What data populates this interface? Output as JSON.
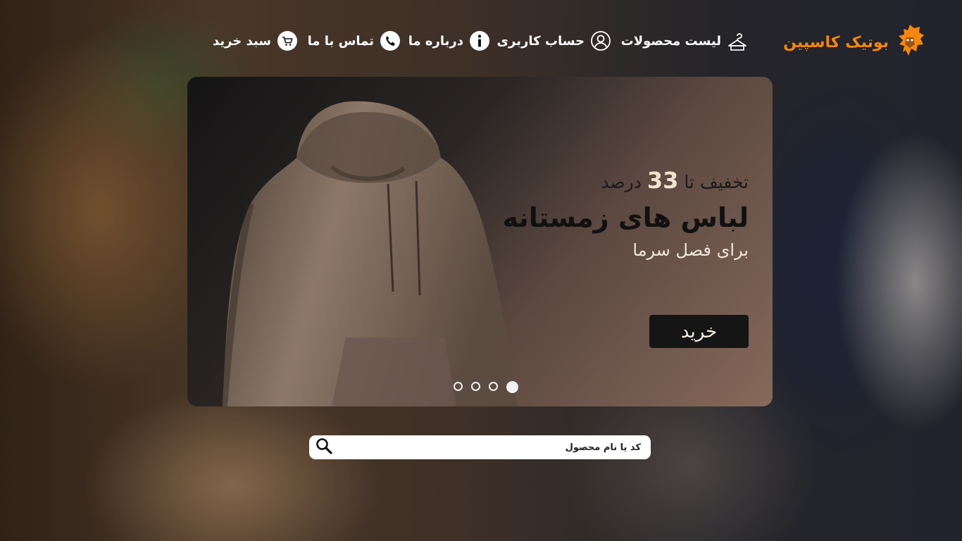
{
  "brand": {
    "name": "بوتیک کاسپین",
    "accent_color": "#f5860f",
    "logo_icon": "lion-icon"
  },
  "nav": {
    "items": [
      {
        "label": "لیست محصولات",
        "icon": "hanger-icon"
      },
      {
        "label": "حساب کاربری",
        "icon": "user-icon"
      },
      {
        "label": "درباره ما",
        "icon": "info-icon"
      },
      {
        "label": "تماس با ما",
        "icon": "phone-icon"
      },
      {
        "label": "سبد خرید",
        "icon": "cart-icon"
      }
    ]
  },
  "banner": {
    "discount_prefix": "تخفیف تا",
    "discount_value": "33",
    "discount_suffix": "درصد",
    "title": "لباس های زمستانه",
    "subtitle": "برای فصل سرما",
    "button_label": "خرید",
    "slides_count": 4,
    "active_slide": 1
  },
  "search": {
    "placeholder": "کد یا نام محصول",
    "icon": "search-icon"
  }
}
